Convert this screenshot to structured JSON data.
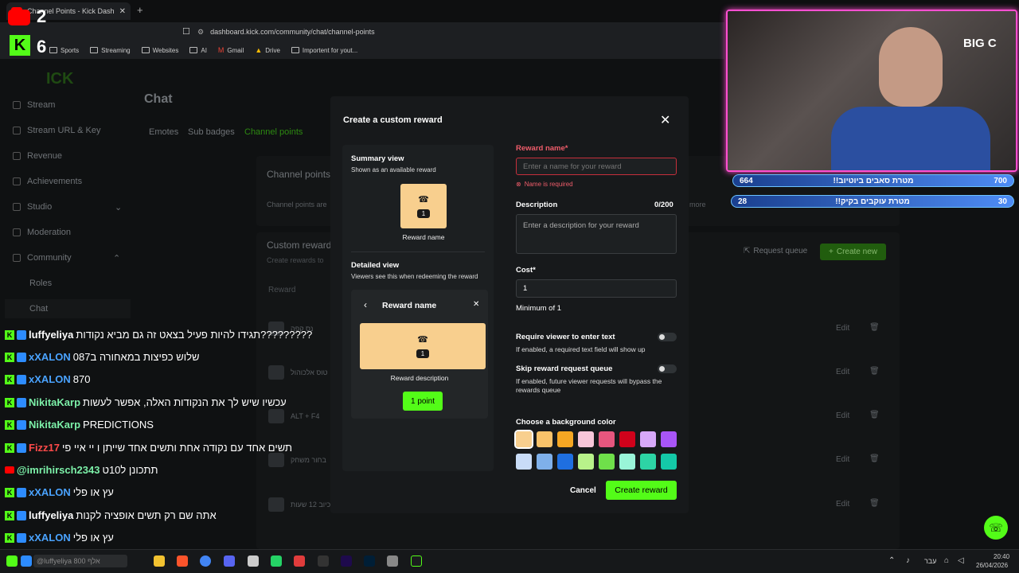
{
  "browser": {
    "tab_title": "Channel Points - Kick Dashboard",
    "url": "dashboard.kick.com/community/chat/channel-points",
    "bookmarks": [
      "Sports",
      "Streaming",
      "Websites",
      "AI",
      "Gmail",
      "Drive",
      "Importent for yout..."
    ]
  },
  "overlay_left": {
    "badge1": "2",
    "badge2": "6"
  },
  "sidebar": {
    "items": [
      "Stream",
      "Stream URL & Key",
      "Revenue",
      "Achievements",
      "Studio",
      "Moderation",
      "Community",
      "Roles",
      "Chat"
    ]
  },
  "main": {
    "title": "Chat",
    "tabs": [
      "Emotes",
      "Sub badges",
      "Channel points"
    ],
    "section_channel": "Channel points",
    "section_channel_sub": "Channel points are",
    "more": "more",
    "custom_title": "Custom rewards",
    "custom_sub": "Create rewards to",
    "request_queue": "Request queue",
    "create_new": "Create new",
    "col_reward": "Reward",
    "rows": [
      {
        "name": "נס קפה",
        "edit": "Edit"
      },
      {
        "name": "טוס אלכוהול",
        "edit": "Edit"
      },
      {
        "name": "ALT + F4",
        "edit": "Edit"
      },
      {
        "name": "בחור משחק",
        "edit": "Edit"
      },
      {
        "name": "כיוב 12 שעות",
        "edit": "Edit"
      }
    ]
  },
  "modal": {
    "title": "Create a custom reward",
    "summary_title": "Summary view",
    "summary_sub": "Shown as an available reward",
    "summary_cost": "1",
    "summary_name": "Reward name",
    "detailed_title": "Detailed view",
    "detailed_sub": "Viewers see this when redeeming the reward",
    "detail_name": "Reward name",
    "detail_cost": "1",
    "detail_desc": "Reward description",
    "detail_button": "1 point",
    "reward_name_label": "Reward name*",
    "reward_name_placeholder": "Enter a name for your reward",
    "reward_name_error": "Name is required",
    "description_label": "Description",
    "description_count": "0/200",
    "description_placeholder": "Enter a description for your reward",
    "cost_label": "Cost*",
    "cost_value": "1",
    "cost_hint": "Minimum of 1",
    "require_text_label": "Require viewer to enter text",
    "require_text_hint": "If enabled, a required text field will show up",
    "skip_queue_label": "Skip reward request queue",
    "skip_queue_hint": "If enabled, future viewer requests will bypass the rewards queue",
    "color_label": "Choose a background color",
    "colors": [
      "#f8cf8e",
      "#f8c26a",
      "#f5a623",
      "#f7c6d9",
      "#e6567e",
      "#d0021b",
      "#d7a8f8",
      "#a855f7",
      "#c9dcf7",
      "#7fb0ea",
      "#1f6fe0",
      "#b8f28a",
      "#6fe04a",
      "#99f5d8",
      "#2dd4a5",
      "#14c9a8"
    ],
    "cancel": "Cancel",
    "create": "Create reward"
  },
  "chat": [
    {
      "user": "luffyeliya",
      "color": "#ffffff",
      "msg": "תגידו להיות פעיל בצאט זה גם מביא נקודות?????????"
    },
    {
      "user": "xXALON",
      "color": "#4aa3ff",
      "msg": "שלוש כפיצות במאחורה ב087"
    },
    {
      "user": "xXALON",
      "color": "#4aa3ff",
      "msg": "870"
    },
    {
      "user": "NikitaKarp",
      "color": "#7cf0a8",
      "msg": "עכשיו שיש לך את הנקודות האלה, אפשר לעשות"
    },
    {
      "user": "NikitaKarp",
      "color": "#7cf0a8",
      "msg": "PREDICTIONS"
    },
    {
      "user": "Fizz17",
      "color": "#ff4a4a",
      "msg": "תשים אחד עם נקודה אחת ותשים אחד שייתן ו יי איי פי"
    },
    {
      "user": "@imrihirsch2343",
      "color": "#7cf0a8",
      "msg": "תתכונן ל10ט"
    },
    {
      "user": "xXALON",
      "color": "#4aa3ff",
      "msg": "עץ או פלי"
    },
    {
      "user": "luffyeliya",
      "color": "#ffffff",
      "msg": "אתה שם רק תשים אופציה לקנות"
    },
    {
      "user": "xXALON",
      "color": "#4aa3ff",
      "msg": "עץ או פלי"
    }
  ],
  "stream_overlay": {
    "logo": "BIG C",
    "bar1_left": "664",
    "bar1_text": "!!מטרת סאבים ביוטיוב",
    "bar1_right": "700",
    "bar2_left": "28",
    "bar2_text": "!!מטרת עוקבים בקיק",
    "bar2_right": "30"
  },
  "taskbar": {
    "search_text": "@luffyeliya אלף 800",
    "lang": "עבר",
    "time": "20:40",
    "date": "26/04/2026"
  }
}
